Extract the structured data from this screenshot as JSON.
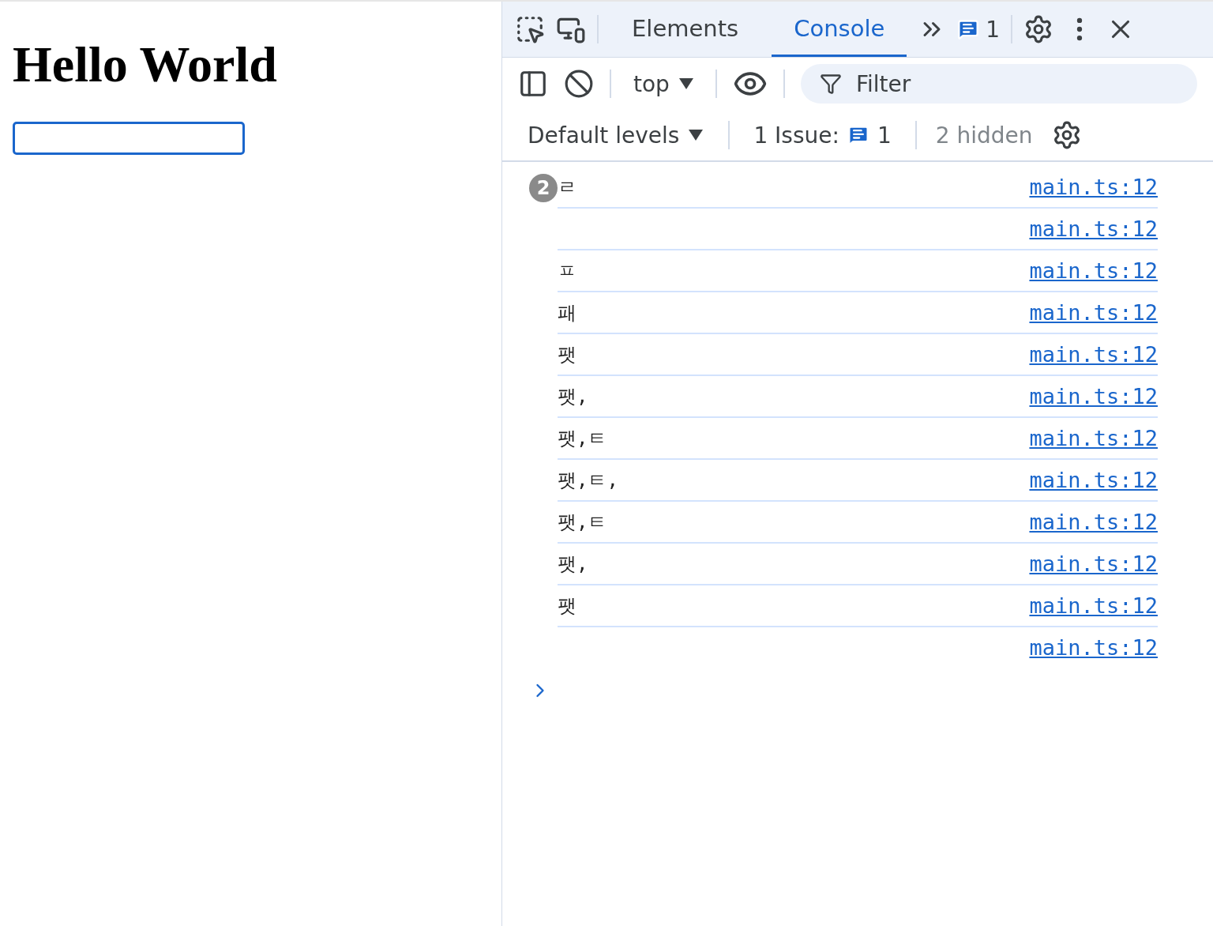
{
  "page": {
    "heading": "Hello World",
    "input": {
      "focused": true
    }
  },
  "devtools": {
    "tabs": [
      {
        "label": "Elements",
        "selected": false
      },
      {
        "label": "Console",
        "selected": true
      }
    ],
    "issues_badge": "1",
    "context": "top",
    "filter": {
      "placeholder": "Filter"
    },
    "levels": "Default levels",
    "issues_label": "1 Issue:",
    "issues_count": "1",
    "hidden": "2 hidden",
    "messages": [
      {
        "repeat": "2",
        "text": "ㄹ",
        "source": "main.ts:12"
      },
      {
        "source": "main.ts:12"
      },
      {
        "text": "ㅍ",
        "source": "main.ts:12"
      },
      {
        "text": "패",
        "source": "main.ts:12"
      },
      {
        "text": "팻",
        "source": "main.ts:12"
      },
      {
        "text": "팻,",
        "source": "main.ts:12"
      },
      {
        "text": "팻,ㅌ",
        "source": "main.ts:12"
      },
      {
        "text": "팻,ㅌ,",
        "source": "main.ts:12"
      },
      {
        "text": "팻,ㅌ",
        "source": "main.ts:12"
      },
      {
        "text": "팻,",
        "source": "main.ts:12"
      },
      {
        "text": "팻",
        "source": "main.ts:12"
      },
      {
        "source": "main.ts:12"
      }
    ]
  }
}
